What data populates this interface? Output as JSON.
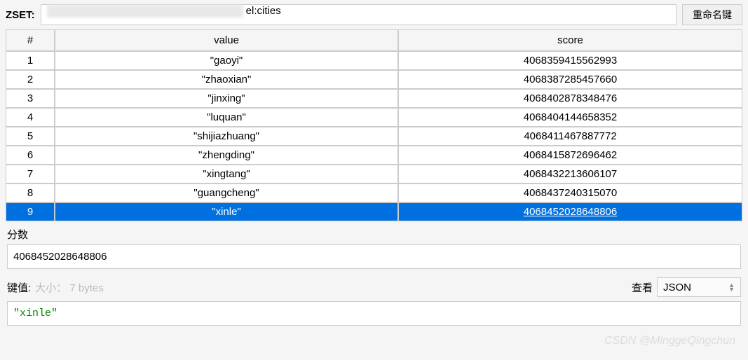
{
  "header": {
    "zset_label": "ZSET:",
    "key_suffix": "el:cities",
    "rename_button": "重命名键"
  },
  "table": {
    "columns": {
      "index": "#",
      "value": "value",
      "score": "score"
    },
    "rows": [
      {
        "index": "1",
        "value": "\"gaoyi\"",
        "score": "4068359415562993"
      },
      {
        "index": "2",
        "value": "\"zhaoxian\"",
        "score": "4068387285457660"
      },
      {
        "index": "3",
        "value": "\"jinxing\"",
        "score": "4068402878348476"
      },
      {
        "index": "4",
        "value": "\"luquan\"",
        "score": "4068404144658352"
      },
      {
        "index": "5",
        "value": "\"shijiazhuang\"",
        "score": "4068411467887772"
      },
      {
        "index": "6",
        "value": "\"zhengding\"",
        "score": "4068415872696462"
      },
      {
        "index": "7",
        "value": "\"xingtang\"",
        "score": "4068432213606107"
      },
      {
        "index": "8",
        "value": "\"guangcheng\"",
        "score": "4068437240315070"
      },
      {
        "index": "9",
        "value": "\"xinle\"",
        "score": "4068452028648806"
      }
    ],
    "selected_index": 8
  },
  "score_section": {
    "label": "分数",
    "value": "4068452028648806"
  },
  "keyvalue_section": {
    "label": "键值:",
    "size_text": "大小： 7 bytes",
    "view_label": "查看",
    "view_format": "JSON",
    "value_display": "\"xinle\""
  },
  "watermark": "CSDN @MinggeQingchun"
}
